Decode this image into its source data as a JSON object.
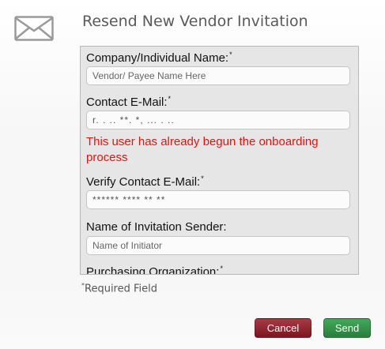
{
  "dialog": {
    "title": "Resend New Vendor Invitation",
    "icon": "envelope-icon"
  },
  "form": {
    "company_name": {
      "label": "Company/Individual Name:",
      "required_mark": "*",
      "placeholder": "Vendor/ Payee Name Here",
      "value": ""
    },
    "contact_email": {
      "label": "Contact E-Mail:",
      "required_mark": "*",
      "value": "r. . .. **. *, ... . ..",
      "error": "This user has already begun the onboarding process"
    },
    "verify_email": {
      "label": "Verify Contact E-Mail:",
      "required_mark": "*",
      "value": "****** **** ** **"
    },
    "sender_name": {
      "label": "Name of Invitation Sender:",
      "placeholder": "Name of Initiator",
      "value": ""
    },
    "purchasing_org": {
      "label": "Purchasing Organization:",
      "required_mark": "*"
    }
  },
  "footer": {
    "required_mark": "*",
    "required_note": "Required Field",
    "cancel_label": "Cancel",
    "send_label": "Send"
  },
  "colors": {
    "error": "#e8120c",
    "cancel_button": "#8e2230",
    "send_button": "#33914a",
    "title": "#5a5a5a"
  }
}
